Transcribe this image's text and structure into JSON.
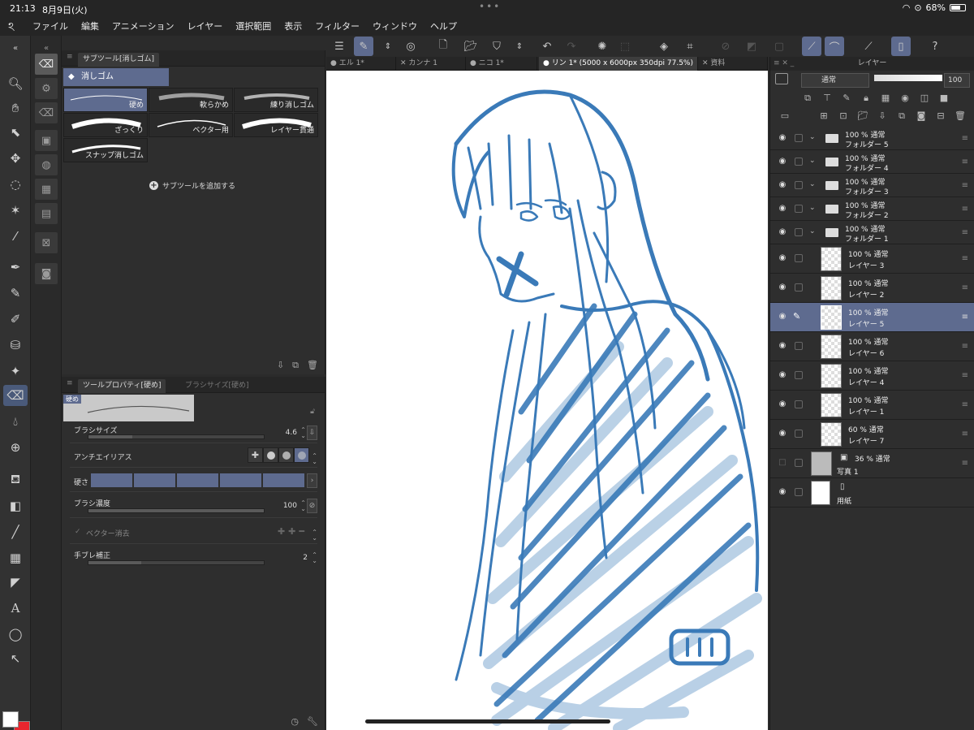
{
  "status": {
    "time": "21:13",
    "date": "8月9日(火)",
    "dots": "•••",
    "battery_pct": "68%"
  },
  "menu": [
    "ファイル",
    "編集",
    "アニメーション",
    "レイヤー",
    "選択範囲",
    "表示",
    "フィルター",
    "ウィンドウ",
    "ヘルプ"
  ],
  "colors": {
    "accent": "#5e6b8f",
    "main_color": "#ffffff",
    "sub_color": "#e8262e",
    "stroke_blue": "#3a7ab8"
  },
  "subtool_panel": {
    "tab_label": "サブツール[消しゴム]",
    "group_label": "消しゴム",
    "brushes": [
      {
        "label": "硬め",
        "selected": true
      },
      {
        "label": "軟らかめ",
        "selected": false
      },
      {
        "label": "練り消しゴム",
        "selected": false
      },
      {
        "label": "ざっくり",
        "selected": false
      },
      {
        "label": "ベクター用",
        "selected": false
      },
      {
        "label": "レイヤー貫通",
        "selected": false
      },
      {
        "label": "スナップ消しゴム",
        "selected": false
      }
    ],
    "add_label": "サブツールを追加する"
  },
  "tool_property": {
    "tab_label": "ツールプロパティ[硬め]",
    "tab2_label": "ブラシサイズ[硬め]",
    "preview_tag": "硬め",
    "brush_size": {
      "label": "ブラシサイズ",
      "value": "4.6",
      "fill": 0.25
    },
    "antialias": {
      "label": "アンチエイリアス"
    },
    "hardness": {
      "label": "硬さ"
    },
    "brush_density": {
      "label": "ブラシ濃度",
      "value": "100",
      "fill": 1.0
    },
    "vector_erase": {
      "label": "ベクター消去"
    },
    "stabilization": {
      "label": "手ブレ補正",
      "value": "2",
      "fill": 0.3
    }
  },
  "doc_tabs": [
    {
      "label": "● エル 1*",
      "active": false
    },
    {
      "label": "✕ カンナ 1",
      "active": false
    },
    {
      "label": "● ニコ 1*",
      "active": false
    },
    {
      "label": "● リン 1* (5000 x 6000px 350dpi 77.5%)",
      "active": true
    },
    {
      "label": "✕ 資料",
      "active": false
    }
  ],
  "layer_panel": {
    "title": "レイヤー",
    "blend_mode": "通常",
    "opacity": "100",
    "layers": [
      {
        "kind": "folder",
        "top": "100 % 通常",
        "name": "フォルダー 5"
      },
      {
        "kind": "folder",
        "top": "100 % 通常",
        "name": "フォルダー 4"
      },
      {
        "kind": "folder",
        "top": "100 % 通常",
        "name": "フォルダー 3"
      },
      {
        "kind": "folder",
        "top": "100 % 通常",
        "name": "フォルダー 2"
      },
      {
        "kind": "folder",
        "top": "100 % 通常",
        "name": "フォルダー 1"
      },
      {
        "kind": "layer",
        "top": "100 % 通常",
        "name": "レイヤー 3"
      },
      {
        "kind": "layer",
        "top": "100 % 通常",
        "name": "レイヤー 2"
      },
      {
        "kind": "layer",
        "top": "100 % 通常",
        "name": "レイヤー 5",
        "selected": true
      },
      {
        "kind": "layer",
        "top": "100 % 通常",
        "name": "レイヤー 6"
      },
      {
        "kind": "layer",
        "top": "100 % 通常",
        "name": "レイヤー 4"
      },
      {
        "kind": "layer",
        "top": "100 % 通常",
        "name": "レイヤー 1"
      },
      {
        "kind": "layer",
        "top": "60 % 通常",
        "name": "レイヤー 7"
      },
      {
        "kind": "photo",
        "top": "36 % 通常",
        "name": "写真 1"
      },
      {
        "kind": "paper",
        "top": "",
        "name": "用紙"
      }
    ]
  }
}
